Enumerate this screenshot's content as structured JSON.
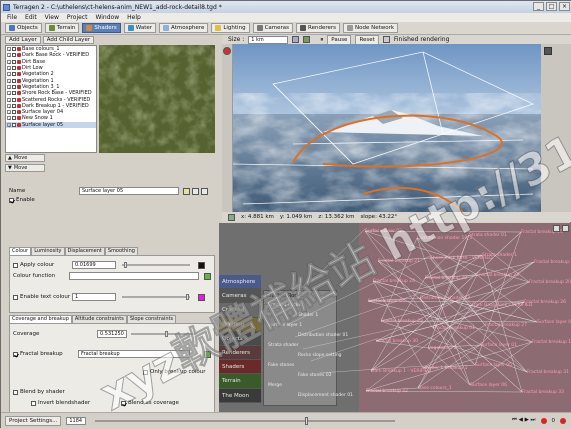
{
  "window": {
    "title": "Terragen 2 - C:\\uthelens\\ct-helens-anim_NEW1_add-rock-detail8.tgd *",
    "min": "_",
    "max": "□",
    "close": "×"
  },
  "menu": [
    "File",
    "Edit",
    "View",
    "Project",
    "Window",
    "Help"
  ],
  "toolbar": {
    "items": [
      {
        "label": "Objects",
        "color": "#4a78c0",
        "active": false
      },
      {
        "label": "Terrain",
        "color": "#6b8a3a",
        "active": false
      },
      {
        "label": "Shaders",
        "color": "#d08a40",
        "active": true
      },
      {
        "label": "Water",
        "color": "#3a90c8",
        "active": false
      },
      {
        "label": "Atmosphere",
        "color": "#8fb0d8",
        "active": false
      },
      {
        "label": "Lighting",
        "color": "#e0c040",
        "active": false
      },
      {
        "label": "Cameras",
        "color": "#777777",
        "active": false
      },
      {
        "label": "Renderers",
        "color": "#555555",
        "active": false
      },
      {
        "label": "Node Network",
        "color": "#999999",
        "active": false
      }
    ]
  },
  "layers": {
    "add_layer": "Add Layer",
    "add_child": "Add Child Layer",
    "items": [
      "Base colours_1",
      "Dark Base Rock - VERIFIED",
      "Dirt Base",
      "Dirt Low",
      "Vegetation 2",
      "Vegetation 1",
      "Vegetation 3_1",
      "Shore Rock Base - VERIFIED",
      "Scattered Rocks - VERIFIED",
      "Dark Breakup 1 - VERIFIED",
      "Surface layer 04",
      "New Snow 1",
      "Surface layer 05"
    ],
    "move_up": "Move",
    "move_down": "Move"
  },
  "props": {
    "name_label": "Name",
    "name_value": "Surface layer 05",
    "enable_label": "Enable",
    "tabs1": [
      "Colour",
      "Luminosity",
      "Displacement",
      "Smoothing"
    ],
    "apply_colour": "Apply colour",
    "apply_colour_value": "0.01699",
    "colour_function": "Colour function",
    "enable_text_colour": "Enable text colour",
    "text_colour_value": "1",
    "tabs2": [
      "Coverage and breakup",
      "Altitude constraints",
      "Slope constraints"
    ],
    "coverage_label": "Coverage",
    "coverage_value": "0.531250",
    "fractal_breakup": "Fractal breakup",
    "fractal_breakup_field": "Fractal breakup",
    "only_breakup_colour": "Only breakup colour",
    "blend_by_shader": "Blend by shader",
    "invert_blendshader": "Invert blendshader",
    "blend_as_coverage": "Blend as coverage"
  },
  "view": {
    "size_label": "Size :",
    "size_value": "1 km",
    "pause": "Pause",
    "reset": "Reset",
    "status": "Finished rendering"
  },
  "coords": {
    "x": "x: 4.881 km",
    "y": "y: 1.049 km",
    "z": "z: 13.362 km",
    "slope": "slope: 43.22°"
  },
  "node_side": [
    "Atmosphere",
    "Cameras",
    "Cracked Rocks",
    "Lighting",
    "Objects",
    "Renderers",
    "Shaders",
    "Terrain",
    "The Moon"
  ],
  "node_colors": [
    "#4a5a8a",
    "#555555",
    "#6a6a6a",
    "#7a6a3a",
    "#4a4a4a",
    "#5a3a3a",
    "#6a2a2a",
    "#3a5a2a",
    "#3a3a3a"
  ],
  "cracked_group": {
    "title": "Cracked Rocks",
    "nodes": [
      "Cracked Rocks",
      "Shader 1",
      "Surface layer 1",
      "Distribution shader 01",
      "Strata shader",
      "Rocks slope setting",
      "Fake stones",
      "Fake stones 02",
      "Merge",
      "Displacement shader 01"
    ]
  },
  "shader_nodes": [
    "Surface layer 02",
    "Distribution shader 19_1",
    "Strata shader 01",
    "Fractal breakup 25",
    "Fractal breakup 21",
    "Shore Rock Base - VERIFIED",
    "Strata shader 1",
    "Fractal breakup 22",
    "Fractal breakup 24",
    "Fractal breakup 28",
    "Fractal breakup 23",
    "Fractal breakup 20",
    "Surface layer 04",
    "Distribution shader 22",
    "Dark Base Rock - VERIFIED",
    "Fractal breakup 26",
    "Fractal breakup 29",
    "Fractal breakup 01",
    "Fractal breakup 27",
    "Surface layer 03",
    "Fractal breakup 30",
    "Vegetation 2",
    "Surface layer 01",
    "Fractal breakup 19",
    "Dark Breakup 1 - VERIFIED",
    "Shader 1 Breakup 1",
    "Surface layer 05",
    "Fractal breakup 31",
    "Fractal breakup 32",
    "Base colours_1",
    "Surface layer 06",
    "Fractal breakup 33"
  ],
  "bottom": {
    "settings": "Project Settings...",
    "frame": "1184",
    "status_dot": "0"
  },
  "watermark": "xyz軟體補給站 http://31.to"
}
